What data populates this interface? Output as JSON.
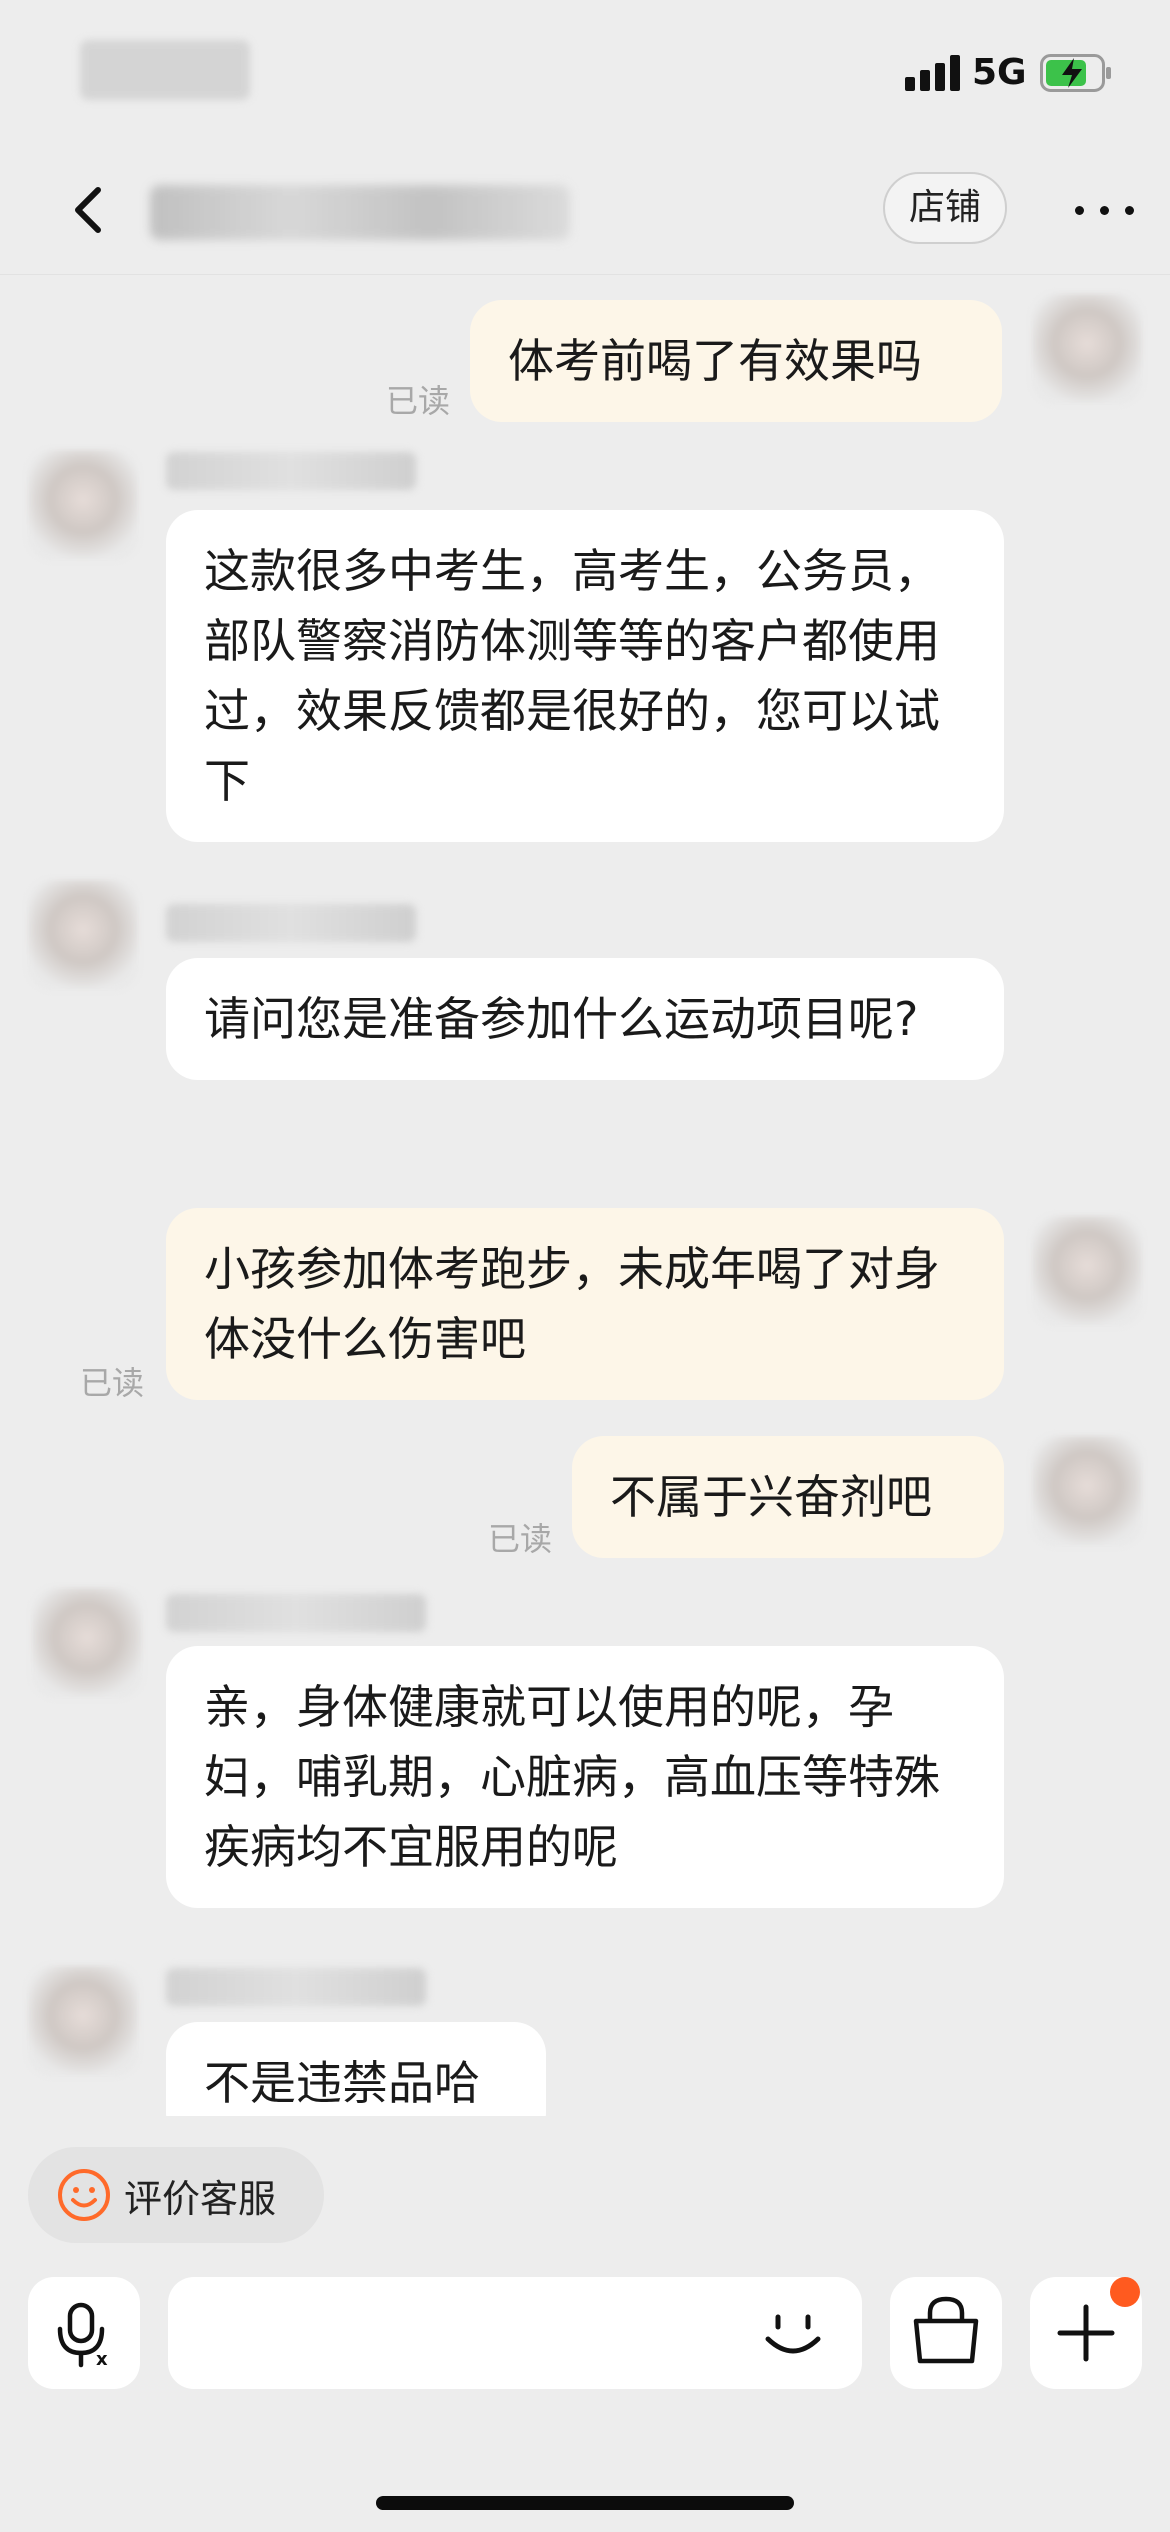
{
  "status_bar": {
    "network": "5G",
    "battery_charging": true,
    "signal_bars": 4
  },
  "nav": {
    "shop_label": "店铺",
    "back_icon": "chevron-left-icon",
    "more_icon": "ellipsis-icon"
  },
  "messages": [
    {
      "side": "out",
      "text": "体考前喝了有效果吗",
      "read_label": "已读"
    },
    {
      "side": "in",
      "text": "这款很多中考生，高考生，公务员，部队警察消防体测等等的客户都使用过，效果反馈都是很好的，您可以试下"
    },
    {
      "side": "in",
      "text": "请问您是准备参加什么运动项目呢?"
    },
    {
      "side": "out",
      "text": "小孩参加体考跑步，未成年喝了对身体没什么伤害吧",
      "read_label": "已读"
    },
    {
      "side": "out",
      "text": "不属于兴奋剂吧",
      "read_label": "已读"
    },
    {
      "side": "in",
      "text": "亲，身体健康就可以使用的呢，孕妇，哺乳期，心脏病，高血压等特殊疾病均不宜服用的呢"
    },
    {
      "side": "in",
      "text": "不是违禁品哈"
    }
  ],
  "footer": {
    "rate_label": "评价客服",
    "input_placeholder": "",
    "colors": {
      "accent": "#ff5a1f",
      "outgoing_bubble": "#fdf6e8",
      "incoming_bubble": "#ffffff"
    }
  }
}
